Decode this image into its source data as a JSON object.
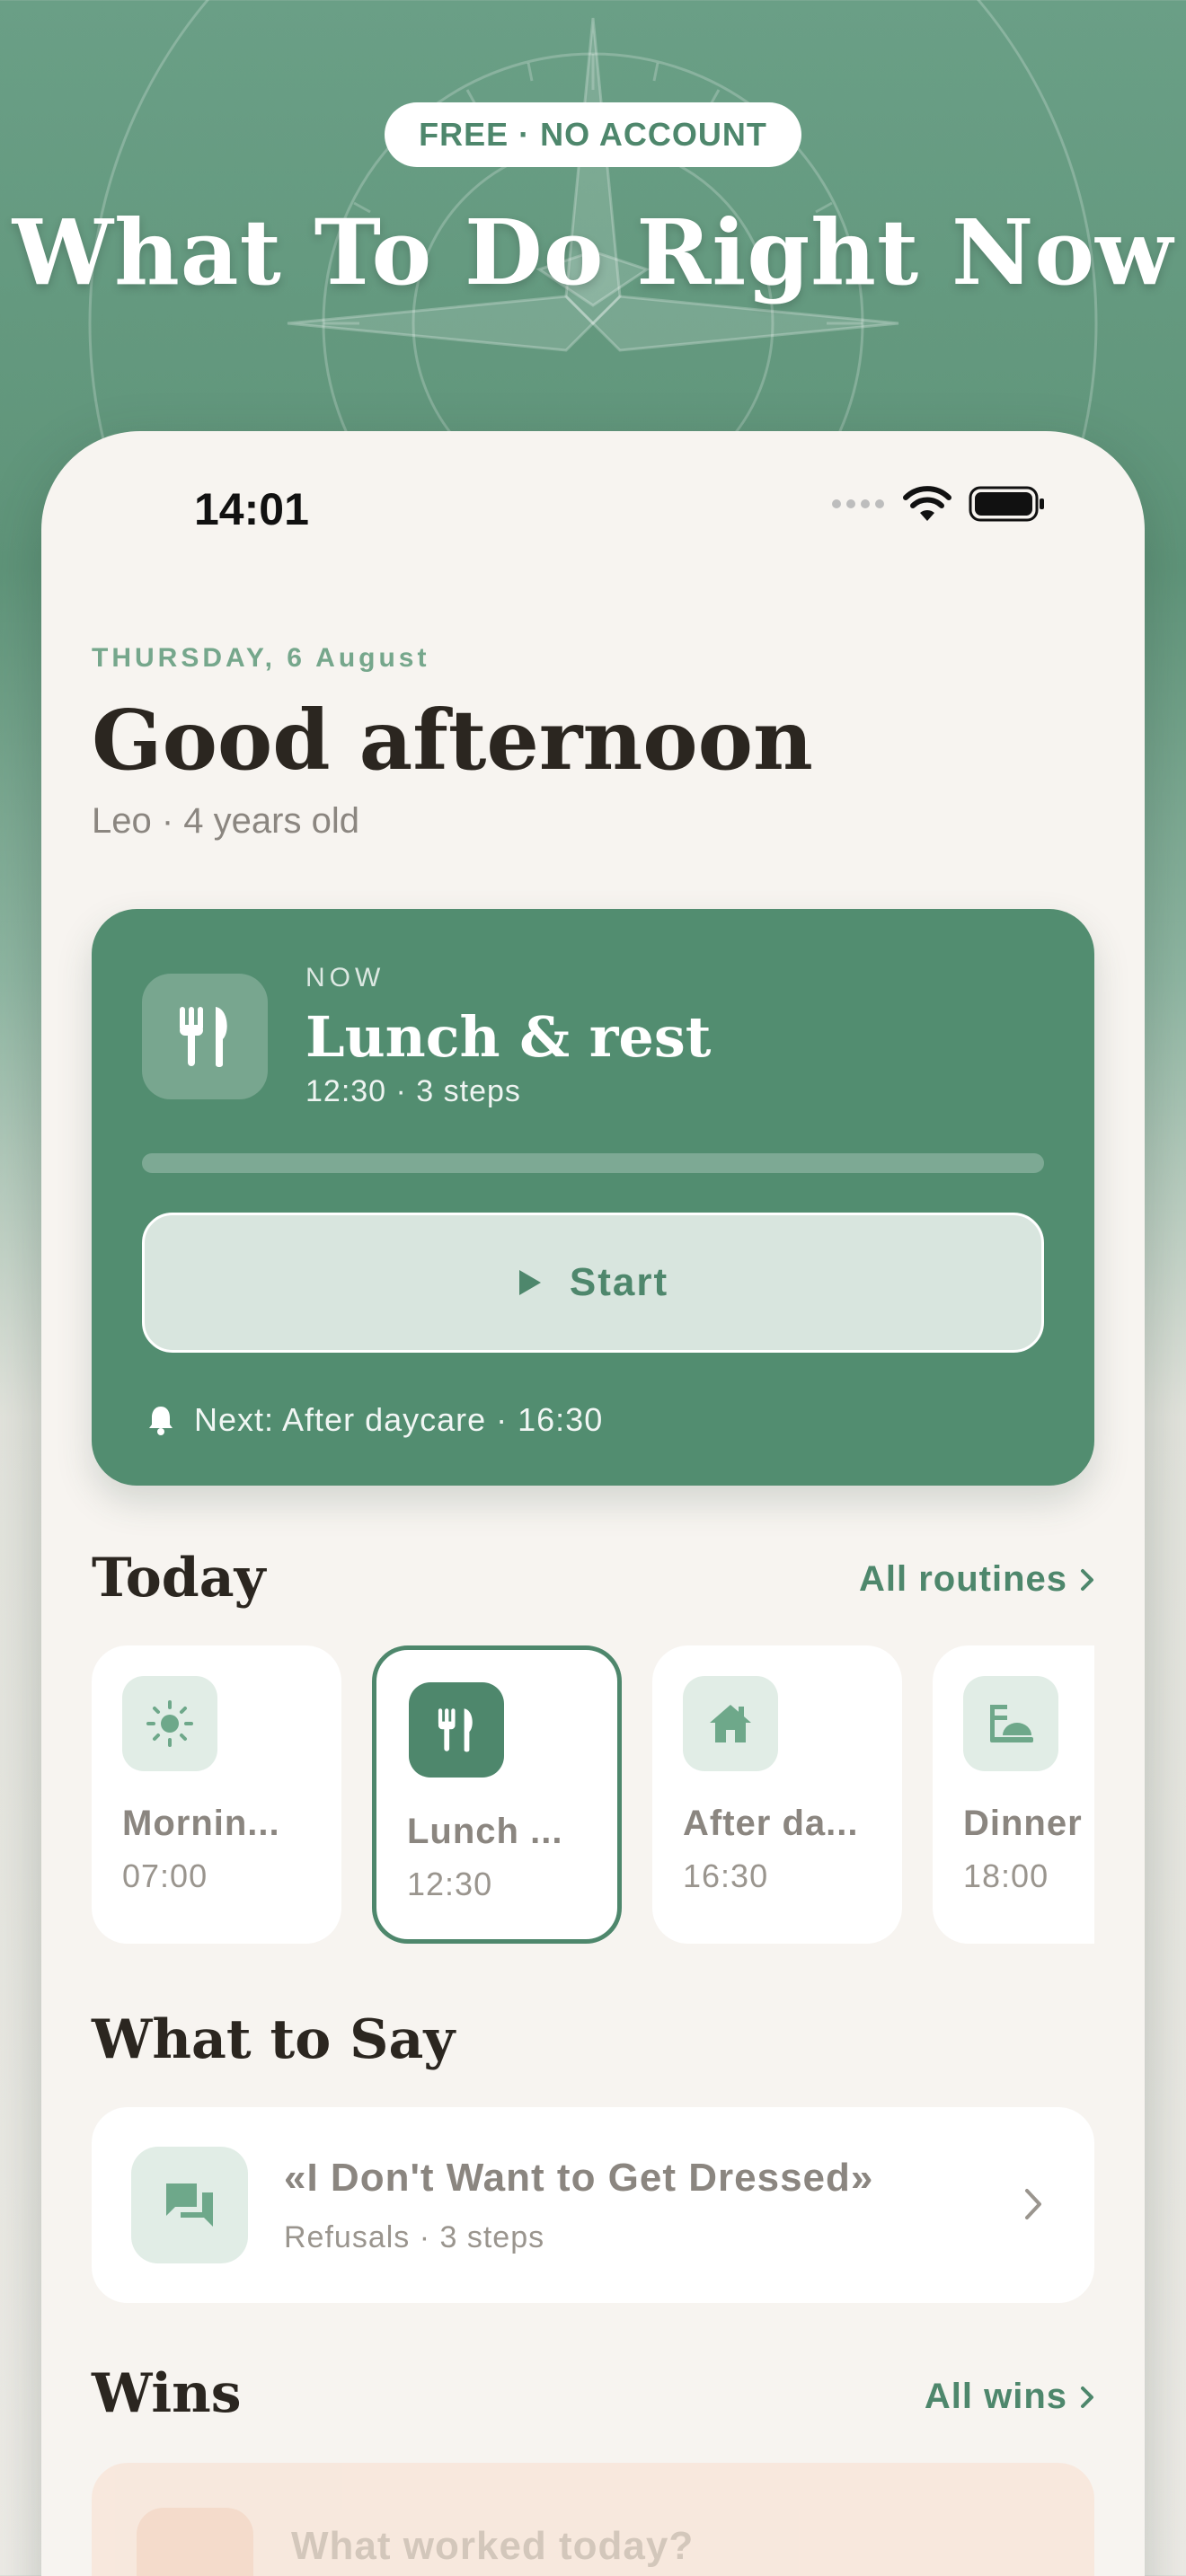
{
  "hero": {
    "badge": "FREE · NO ACCOUNT",
    "title": "What To Do Right Now"
  },
  "status_bar": {
    "time": "14:01"
  },
  "header": {
    "date": "THURSDAY, 6 August",
    "greeting": "Good afternoon",
    "child": "Leo · 4 years old"
  },
  "now_card": {
    "label": "NOW",
    "title": "Lunch & rest",
    "subtitle": "12:30 · 3 steps",
    "progress": 0,
    "start_label": "Start",
    "next": "Next: After daycare · 16:30",
    "icon": "fork-knife-icon"
  },
  "today": {
    "title": "Today",
    "link": "All routines",
    "routines": [
      {
        "name": "Mornin...",
        "time": "07:00",
        "icon": "sun-icon",
        "active": false
      },
      {
        "name": "Lunch ...",
        "time": "12:30",
        "icon": "fork-knife-icon",
        "active": true
      },
      {
        "name": "After da...",
        "time": "16:30",
        "icon": "home-icon",
        "active": false
      },
      {
        "name": "Dinner",
        "time": "18:00",
        "icon": "dinner-icon",
        "active": false
      }
    ]
  },
  "what_to_say": {
    "title": "What to Say",
    "card_title": "«I Don't Want to Get Dressed»",
    "card_sub": "Refusals · 3 steps",
    "icon": "chat-icon"
  },
  "wins": {
    "title": "Wins",
    "link": "All wins",
    "card_text": "What worked today?"
  },
  "colors": {
    "accent": "#528d70",
    "accent_dark": "#4e876c",
    "page_bg": "#f7f4f0"
  }
}
